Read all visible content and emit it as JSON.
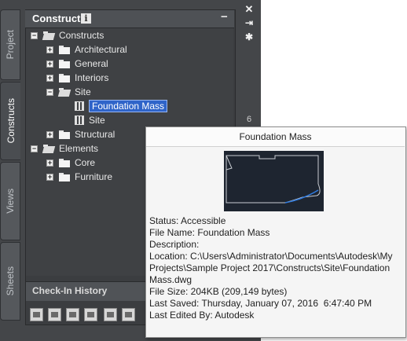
{
  "side_tabs": [
    {
      "label": "Project"
    },
    {
      "label": "Constructs"
    },
    {
      "label": "Views"
    },
    {
      "label": "Sheets"
    }
  ],
  "panel": {
    "title": "Constructs",
    "info_glyph": "i",
    "collapse_glyph": "−"
  },
  "tree": [
    {
      "label": "Constructs",
      "expander": "−",
      "icon": "folder-open-icon"
    },
    {
      "label": "Architectural",
      "expander": "+",
      "icon": "folder-icon"
    },
    {
      "label": "General",
      "expander": "+",
      "icon": "folder-icon"
    },
    {
      "label": "Interiors",
      "expander": "+",
      "icon": "folder-icon"
    },
    {
      "label": "Site",
      "expander": "−",
      "icon": "folder-open-icon"
    },
    {
      "label": "Foundation Mass",
      "icon": "construct-icon",
      "selected": true
    },
    {
      "label": "Site",
      "icon": "construct-icon"
    },
    {
      "label": "Structural",
      "expander": "+",
      "icon": "folder-icon"
    },
    {
      "label": "Elements",
      "expander": "−",
      "icon": "folder-open-icon"
    },
    {
      "label": "Core",
      "expander": "+",
      "icon": "folder-icon"
    },
    {
      "label": "Furniture",
      "expander": "+",
      "icon": "folder-icon"
    }
  ],
  "checkin": {
    "title": "Check-In History"
  },
  "right_strip": {
    "close_glyph": "✕",
    "pin_glyph": "⇥",
    "settings_glyph": "✱",
    "edge_text": "6"
  },
  "popup": {
    "title": "Foundation Mass",
    "lines": [
      "Status: Accessible",
      "File Name: Foundation Mass",
      "Description:",
      "Location: C:\\Users\\Administrator\\Documents\\Autodesk\\My",
      "Projects\\Sample Project 2017\\Constructs\\Site\\Foundation",
      "Mass.dwg",
      "File Size: 204KB (209,149 bytes)",
      "Last Saved: Thursday, January 07, 2016  6:47:40 PM",
      "Last Edited By: Autodesk"
    ]
  },
  "colors": {
    "selection": "#2f64c9",
    "palette_bg": "#444649"
  }
}
